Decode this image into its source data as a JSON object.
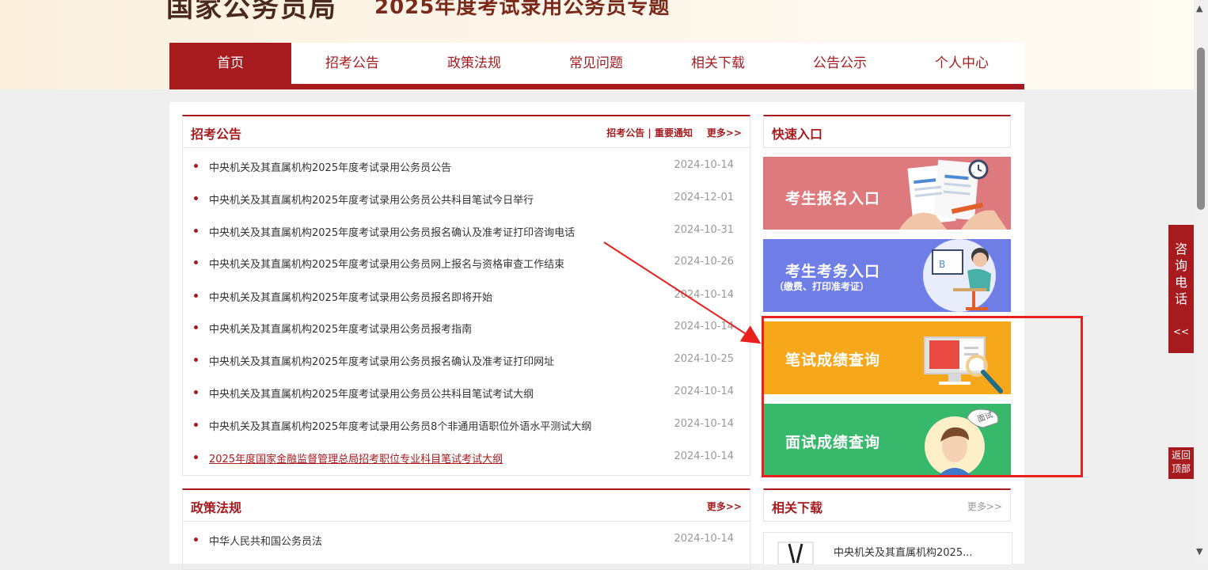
{
  "header": {
    "site_title": "国家公务员局",
    "page_title": "2025年度考试录用公务员专题"
  },
  "nav": {
    "items": [
      "首页",
      "招考公告",
      "政策法规",
      "常见问题",
      "相关下载",
      "公告公示",
      "个人中心"
    ],
    "active_index": 0
  },
  "announcements": {
    "title": "招考公告",
    "links": "招考公告 | 重要通知",
    "more": "更多>>",
    "items": [
      {
        "text": "中央机关及其直属机构2025年度考试录用公务员公告",
        "date": "2024-10-14"
      },
      {
        "text": "中央机关及其直属机构2025年度考试录用公务员公共科目笔试今日举行",
        "date": "2024-12-01"
      },
      {
        "text": "中央机关及其直属机构2025年度考试录用公务员报名确认及准考证打印咨询电话",
        "date": "2024-10-31"
      },
      {
        "text": "中央机关及其直属机构2025年度考试录用公务员网上报名与资格审查工作结束",
        "date": "2024-10-26"
      },
      {
        "text": "中央机关及其直属机构2025年度考试录用公务员报名即将开始",
        "date": "2024-10-14"
      },
      {
        "text": "中央机关及其直属机构2025年度考试录用公务员报考指南",
        "date": "2024-10-14"
      },
      {
        "text": "中央机关及其直属机构2025年度考试录用公务员报名确认及准考证打印网址",
        "date": "2024-10-25"
      },
      {
        "text": "中央机关及其直属机构2025年度考试录用公务员公共科目笔试考试大纲",
        "date": "2024-10-14"
      },
      {
        "text": "中央机关及其直属机构2025年度考试录用公务员8个非通用语职位外语水平测试大纲",
        "date": "2024-10-14"
      },
      {
        "text": "2025年度国家金融监督管理总局招考职位专业科目笔试考试大纲",
        "date": "2024-10-14"
      }
    ]
  },
  "quick": {
    "title": "快速入口",
    "buttons": [
      {
        "label": "考生报名入口",
        "sub": ""
      },
      {
        "label": "考生考务入口",
        "sub": "（缴费、打印准考证）"
      },
      {
        "label": "笔试成绩查询",
        "sub": ""
      },
      {
        "label": "面试成绩查询",
        "sub": ""
      }
    ],
    "interview_tag": "面试"
  },
  "policy": {
    "title": "政策法规",
    "more": "更多>>",
    "items": [
      {
        "text": "中华人民共和国公务员法",
        "date": "2024-10-14"
      }
    ]
  },
  "downloads": {
    "title": "相关下载",
    "more": "更多>>",
    "items": [
      {
        "text": "中央机关及其直属机构2025..."
      }
    ]
  },
  "side": {
    "consult_label": "咨询电话",
    "consult_arrow": "<<",
    "back_top": "返回顶部"
  },
  "colors": {
    "brand": "#a71b1f",
    "btn_register": "#de7a7d",
    "btn_exam": "#6f7ee6",
    "btn_written": "#f7a81a",
    "btn_interview": "#37b86b",
    "annotation": "#e8201e"
  }
}
